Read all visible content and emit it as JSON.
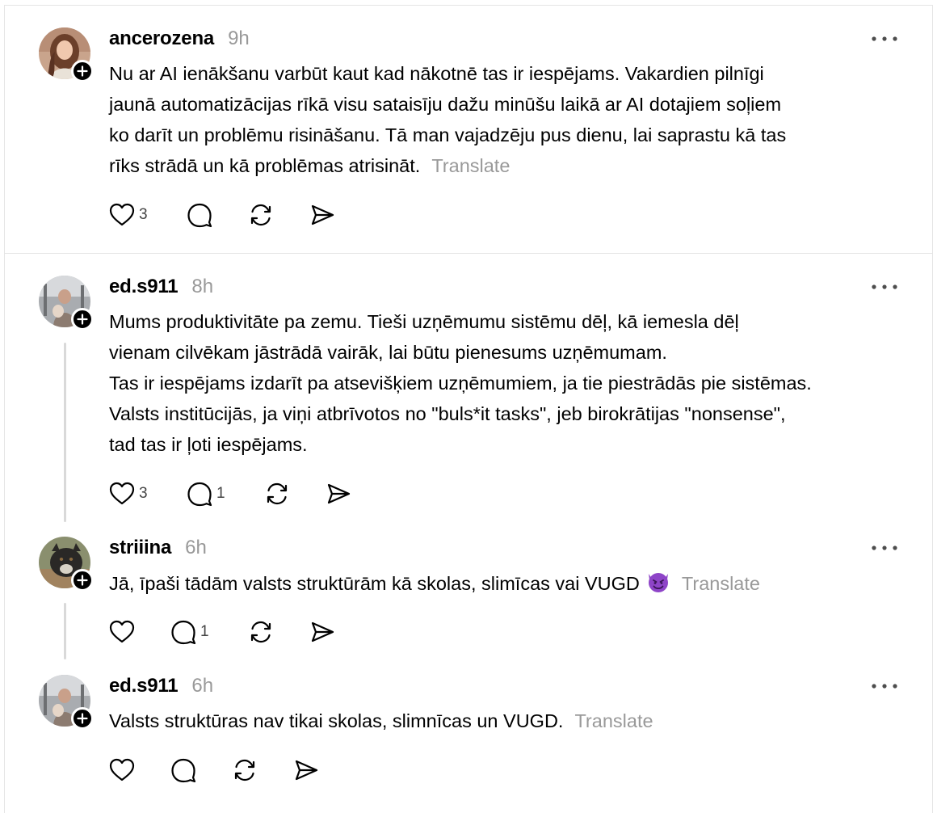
{
  "posts": [
    {
      "username": "ancerozena",
      "time": "9h",
      "lines": [
        "Nu ar AI ienākšanu varbūt kaut kad nākotnē tas ir iespējams. Vakardien pilnīgi",
        "jaunā automatizācijas rīkā visu sataisīju dažu minūšu laikā ar AI dotajiem soļiem",
        "ko darīt un problēmu risināšanu. Tā man vajadzēju pus dienu, lai saprastu kā tas",
        "rīks strādā un kā problēmas atrisināt."
      ],
      "translate": "Translate",
      "likes": "3",
      "replies": ""
    },
    {
      "username": "ed.s911",
      "time": "8h",
      "lines": [
        "Mums produktivitāte pa zemu. Tieši uzņēmumu sistēmu dēļ, kā iemesla dēļ",
        "vienam cilvēkam jāstrādā vairāk, lai būtu pienesums uzņēmumam.",
        "Tas ir iespējams izdarīt pa atsevišķiem uzņēmumiem, ja tie piestrādās pie sistēmas.",
        "Valsts institūcijās, ja viņi atbrīvotos no \"buls*it tasks\", jeb birokrātijas \"nonsense\",",
        "tad tas ir ļoti iespējams."
      ],
      "likes": "3",
      "replies": "1"
    },
    {
      "username": "striiina",
      "time": "6h",
      "lines": [
        "Jā, īpaši tādām valsts struktūrām kā skolas, slimīcas vai VUGD"
      ],
      "emoji": "smiling-face-with-horns-emoji",
      "translate": "Translate",
      "likes": "",
      "replies": "1"
    },
    {
      "username": "ed.s911",
      "time": "6h",
      "lines": [
        "Valsts struktūras nav tikai skolas, slimnīcas un VUGD."
      ],
      "translate": "Translate",
      "likes": "",
      "replies": ""
    }
  ],
  "icons": {
    "like": "heart-icon",
    "reply": "comment-bubble-icon",
    "repost": "repost-icon",
    "share": "send-icon",
    "more": "more-dots-icon",
    "follow": "plus-icon"
  },
  "colors": {
    "muted": "#999999",
    "divider": "#e5e5e5",
    "thread_line": "#d9d9d9",
    "text": "#000000"
  }
}
